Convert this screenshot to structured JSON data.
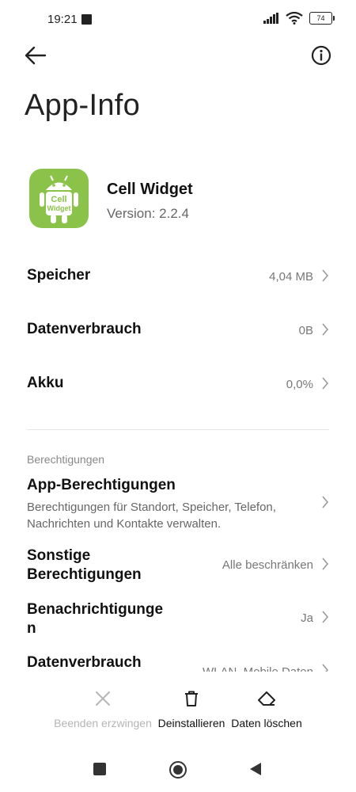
{
  "status_bar": {
    "time": "19:21",
    "battery": "74"
  },
  "header": {
    "title": "App-Info"
  },
  "app": {
    "name": "Cell Widget",
    "version": "Version: 2.2.4",
    "icon_text_line1": "Cell",
    "icon_text_line2": "Widget",
    "icon_color": "#8bc34a"
  },
  "rows": {
    "storage": {
      "label": "Speicher",
      "value": "4,04 MB"
    },
    "data_usage": {
      "label": "Datenverbrauch",
      "value": "0B"
    },
    "battery": {
      "label": "Akku",
      "value": "0,0%"
    }
  },
  "permissions": {
    "section_title": "Berechtigungen",
    "app_permissions": {
      "label": "App-Berechtigungen",
      "description": "Berechtigungen für Standort, Speicher, Telefon, Nachrichten und Kontakte verwalten."
    },
    "other_permissions": {
      "label_line1": "Sonstige",
      "label_line2": "Berechtigungen",
      "value": "Alle beschränken"
    },
    "notifications": {
      "label_line1": "Benachrichtigunge",
      "label_line2": "n",
      "value": "Ja"
    },
    "data_usage_2": {
      "label": "Datenverbrauch",
      "value": "WLAN, Mobile Daten"
    }
  },
  "actions": {
    "force_stop": "Beenden erzwingen",
    "uninstall": "Deinstallieren",
    "clear_data": "Daten löschen"
  },
  "colors": {
    "accent_disabled": "#b5b5b5",
    "text_primary": "#111111",
    "text_secondary": "#777777"
  }
}
